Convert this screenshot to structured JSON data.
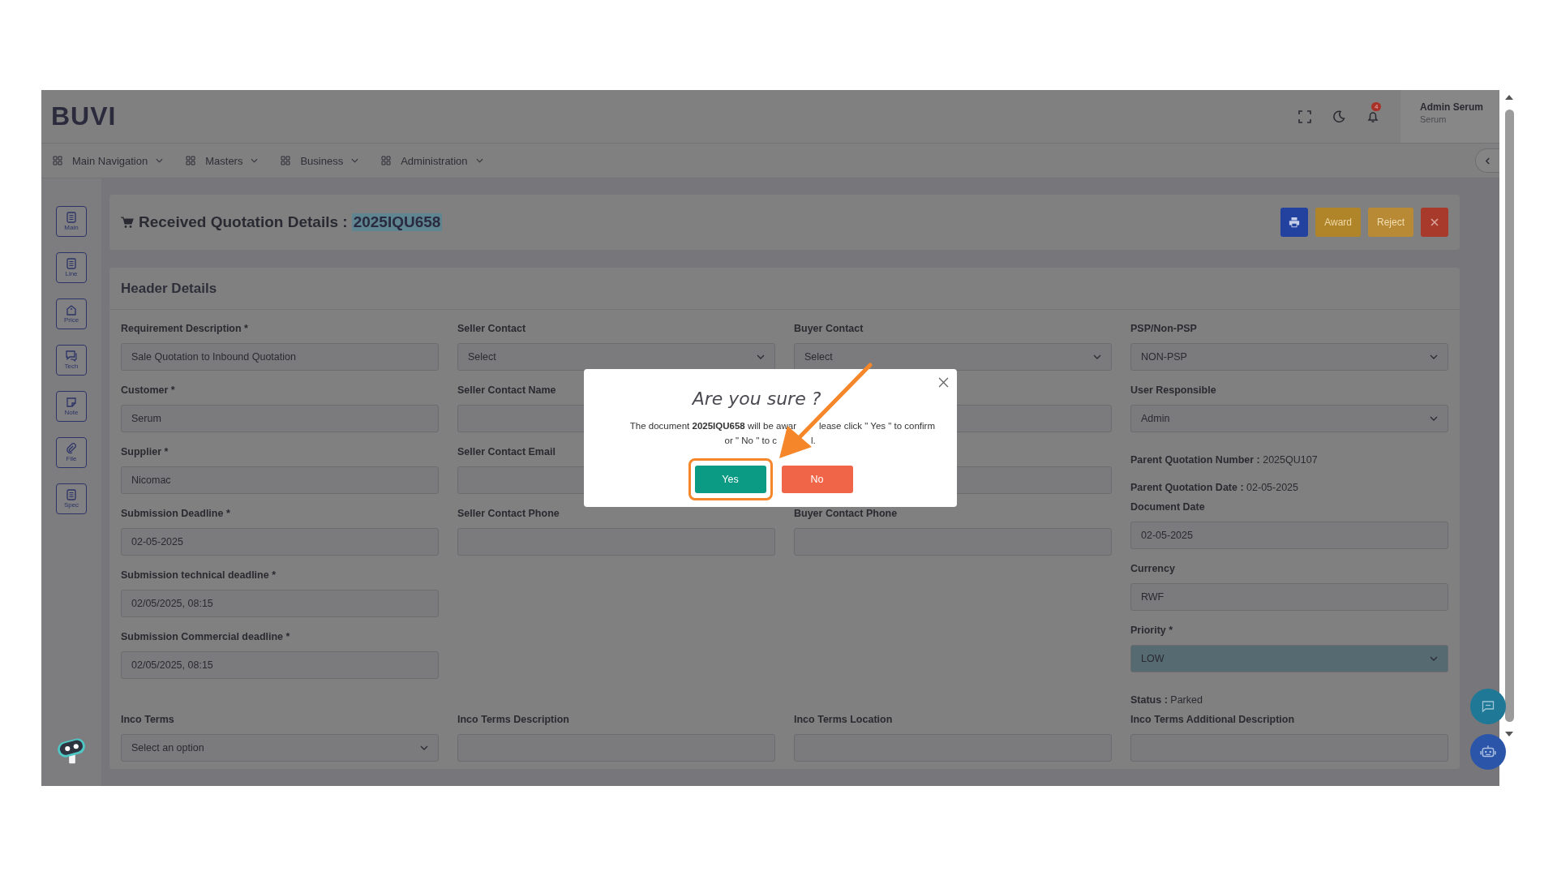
{
  "brand": "BUVI",
  "header": {
    "notifications": "4",
    "user": {
      "name": "Admin Serum",
      "role": "Serum"
    }
  },
  "nav": [
    {
      "label": "Main Navigation"
    },
    {
      "label": "Masters"
    },
    {
      "label": "Business"
    },
    {
      "label": "Administration"
    }
  ],
  "sidebar": [
    {
      "label": "Main",
      "kind": "list"
    },
    {
      "label": "Line",
      "kind": "list"
    },
    {
      "label": "Price",
      "kind": "tag"
    },
    {
      "label": "Tech",
      "kind": "chat"
    },
    {
      "label": "Note",
      "kind": "note"
    },
    {
      "label": "File",
      "kind": "clip"
    },
    {
      "label": "Spec",
      "kind": "list"
    }
  ],
  "page": {
    "title": "Received Quotation Details :",
    "document_number": "2025IQU658",
    "actions": [
      {
        "kind": "print"
      },
      {
        "kind": "text",
        "label": "Award"
      },
      {
        "kind": "text",
        "label": "Reject"
      },
      {
        "kind": "close"
      }
    ]
  },
  "section": {
    "title": "Header Details",
    "columns": [
      [
        {
          "kind": "input",
          "label": "Requirement Description *",
          "value": "Sale Quotation to Inbound Quotation"
        },
        {
          "kind": "input",
          "label": "Customer *",
          "value": "Serum"
        },
        {
          "kind": "input",
          "label": "Supplier *",
          "value": "Nicomac"
        },
        {
          "kind": "input",
          "label": "Submission Deadline *",
          "value": "02-05-2025"
        },
        {
          "kind": "input",
          "label": "Submission technical deadline *",
          "value": "02/05/2025, 08:15"
        },
        {
          "kind": "input",
          "label": "Submission Commercial deadline *",
          "value": "02/05/2025, 08:15"
        }
      ],
      [
        {
          "kind": "select",
          "label": "Seller Contact",
          "value": "Select"
        },
        {
          "kind": "input",
          "label": "Seller Contact Name"
        },
        {
          "kind": "input",
          "label": "Seller Contact Email"
        },
        {
          "kind": "input",
          "label": "Seller Contact Phone"
        }
      ],
      [
        {
          "kind": "select",
          "label": "Buyer Contact",
          "value": "Select"
        },
        {
          "kind": "input"
        },
        {
          "kind": "input"
        },
        {
          "kind": "input",
          "label": "Buyer Contact Phone"
        }
      ],
      [
        {
          "kind": "select",
          "label": "PSP/Non-PSP",
          "value": "NON-PSP"
        },
        {
          "kind": "select",
          "label": "User Responsible",
          "value": "Admin"
        },
        {
          "kind": "info",
          "label": "Parent Quotation Number :",
          "value": "2025QU107"
        },
        {
          "kind": "info",
          "label": "Parent Quotation Date :",
          "value": "02-05-2025"
        },
        {
          "kind": "input",
          "label": "Document Date",
          "value": "02-05-2025"
        },
        {
          "kind": "input",
          "label": "Currency",
          "value": "RWF"
        },
        {
          "kind": "select",
          "label": "Priority *",
          "value": "LOW",
          "highlighted": true
        },
        {
          "kind": "info",
          "label": "Status :",
          "value": "Parked"
        }
      ]
    ],
    "bottom": [
      {
        "kind": "select",
        "label": "Inco Terms",
        "value": "Select an option"
      },
      {
        "kind": "input",
        "label": "Inco Terms Description"
      },
      {
        "kind": "input",
        "label": "Inco Terms Location"
      },
      {
        "kind": "input",
        "label": "Inco Terms Additional Description"
      }
    ]
  },
  "dialog": {
    "title": "Are you sure ?",
    "message_lines": [
      [
        "The document **2025IQU658** will be awar",
        "lease click \" Yes \" to confirm"
      ],
      [
        "or \" No \" to c",
        "l."
      ]
    ],
    "buttons": [
      {
        "label": "Yes",
        "kind": "confirm",
        "highlighted": true
      },
      {
        "label": "No",
        "kind": "cancel",
        "highlighted": false
      }
    ]
  }
}
